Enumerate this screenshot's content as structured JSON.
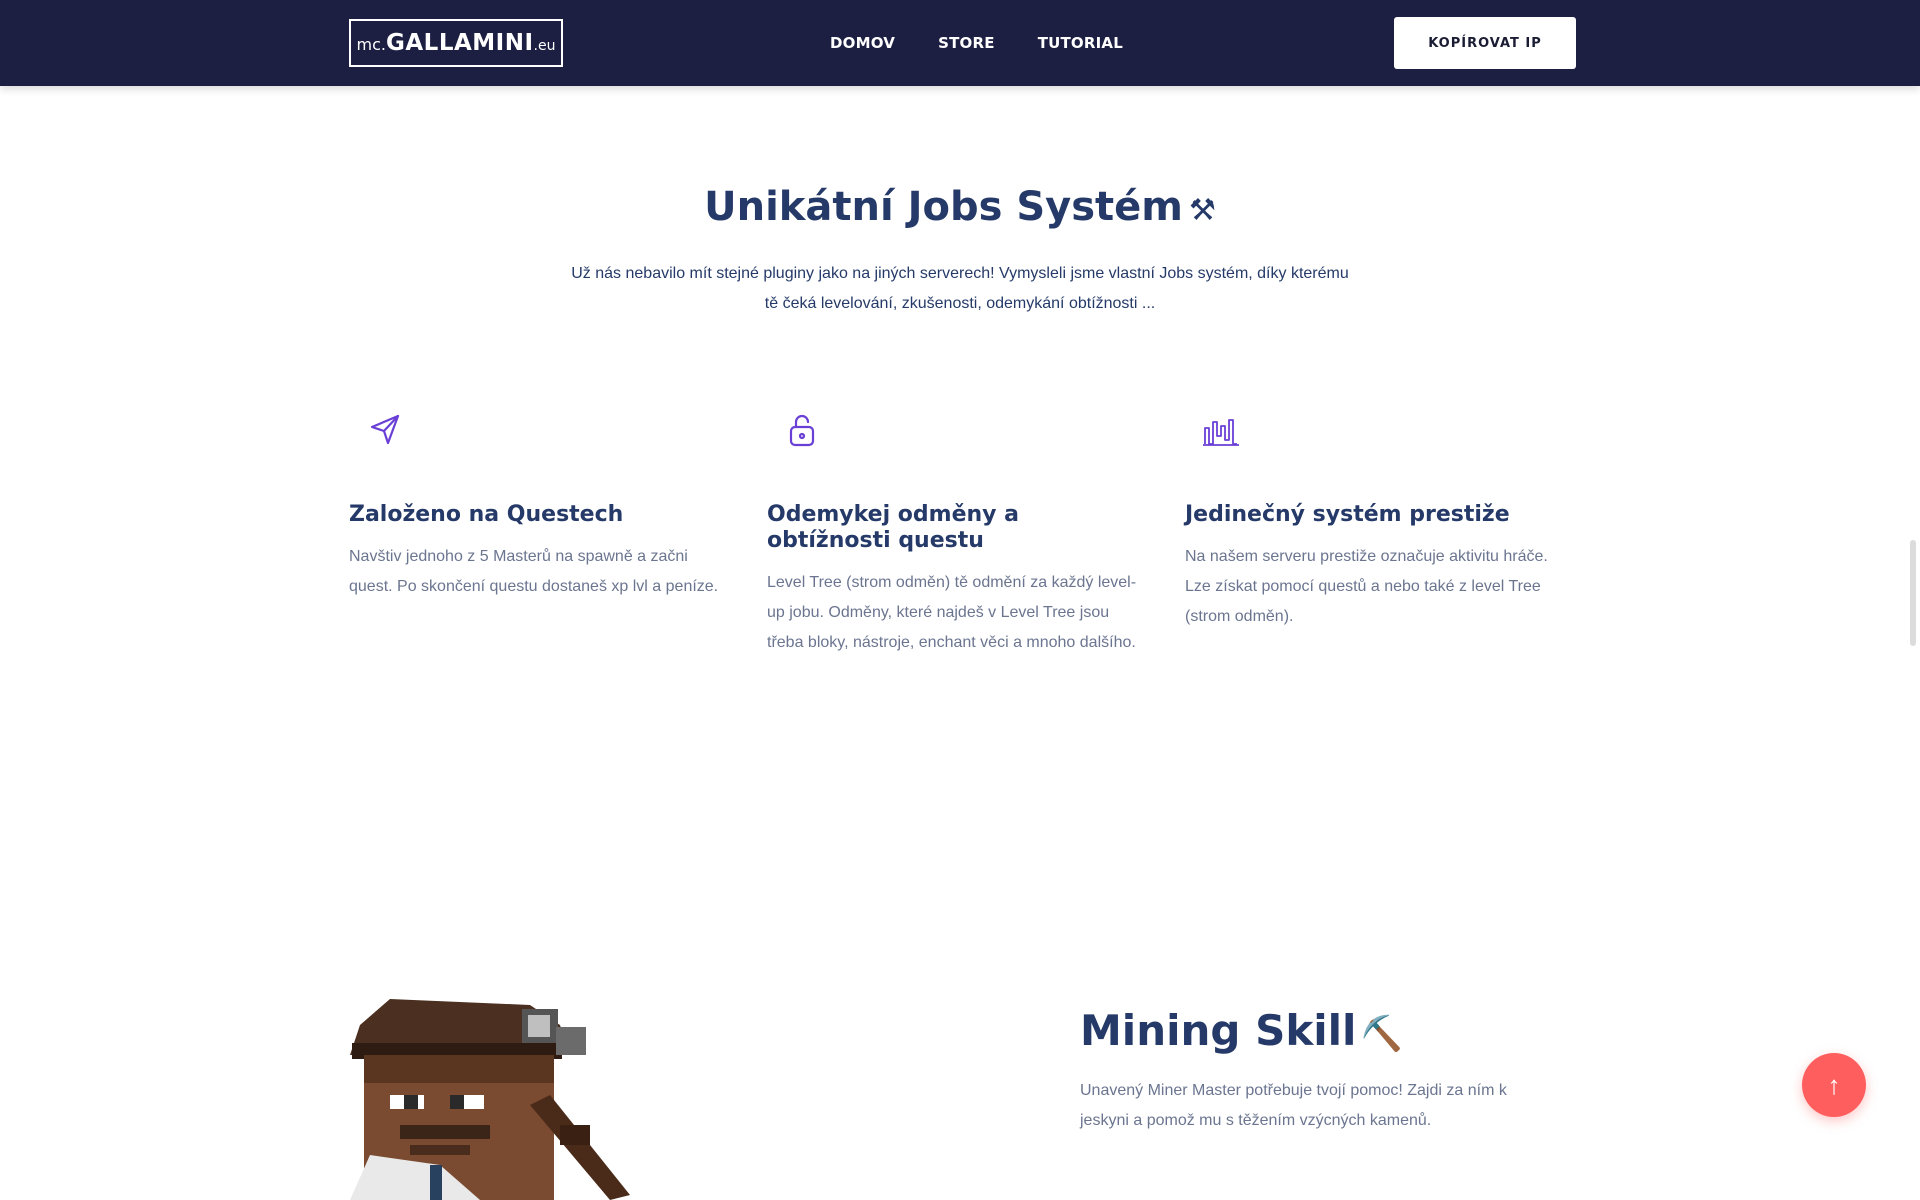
{
  "navbar": {
    "logo": {
      "pre": "mc.",
      "main": "GALLAMINI",
      "post": ".eu"
    },
    "links": [
      "DOMOV",
      "STORE",
      "TUTORIAL"
    ],
    "copy_ip_label": "KOPÍROVAT IP"
  },
  "jobs": {
    "title": "Unikátní Jobs Systém",
    "title_emoji": "⚒",
    "description": "Už nás nebavilo mít stejné pluginy jako na jiných serverech! Vymysleli jsme vlastní Jobs systém, díky kterému tě čeká levelování, zkušenosti, odemykání obtížnosti ...",
    "features": [
      {
        "icon": "send-icon",
        "title": "Založeno na Questech",
        "text": "Navštiv jednoho z 5 Masterů na spawně a začni quest. Po skončení questu dostaneš xp lvl a peníze."
      },
      {
        "icon": "unlock-icon",
        "title": "Odemykej odměny a obtížnosti questu",
        "text": "Level Tree (strom odměn) tě odmění za každý level-up jobu. Odměny, které najdeš v Level Tree jsou třeba bloky, nástroje, enchant věci a mnoho dalšího."
      },
      {
        "icon": "bar-chart-icon",
        "title": "Jedinečný systém prestiže",
        "text": "Na našem serveru prestiže označuje aktivitu hráče. Lze získat pomocí questů a nebo také z level Tree (strom odměn)."
      }
    ]
  },
  "mining": {
    "title": "Mining Skill",
    "title_emoji": "⛏️",
    "description": "Unavený Miner Master potřebuje tvojí pomoc! Zajdi za ním k jeskyni a pomož mu s těžením vzýcných kamenů."
  },
  "colors": {
    "navbar": "#1c1f42",
    "heading": "#253a68",
    "icon_accent": "#6a3fd6",
    "to_top": "#ff5e5e"
  },
  "to_top_label": "↑"
}
